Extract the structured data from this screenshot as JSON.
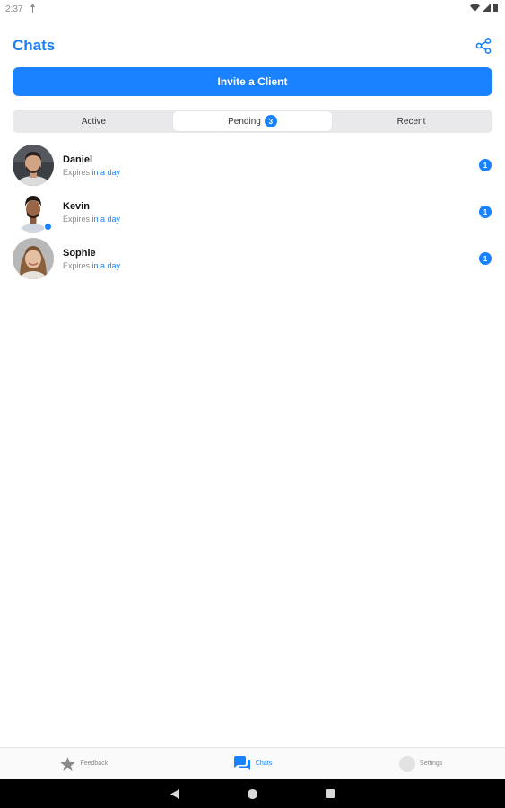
{
  "status_bar": {
    "time": "2:37"
  },
  "header": {
    "title": "Chats"
  },
  "invite": {
    "label": "Invite a Client"
  },
  "tabs": [
    {
      "label": "Active",
      "badge": ""
    },
    {
      "label": "Pending",
      "badge": "3"
    },
    {
      "label": "Recent",
      "badge": ""
    }
  ],
  "selected_tab": "Pending",
  "chats": [
    {
      "name": "Daniel",
      "expires_prefix": "Expires",
      "expires_value": "in a day",
      "unread": "1",
      "online": false
    },
    {
      "name": "Kevin",
      "expires_prefix": "Expires",
      "expires_value": "in a day",
      "unread": "1",
      "online": true
    },
    {
      "name": "Sophie",
      "expires_prefix": "Expires",
      "expires_value": "in a day",
      "unread": "1",
      "online": false
    }
  ],
  "bottom_nav": [
    {
      "label": "Feedback",
      "icon": "star-icon"
    },
    {
      "label": "Chats",
      "icon": "chat-bubbles-icon"
    },
    {
      "label": "Settings",
      "icon": "settings-avatar-icon"
    }
  ],
  "active_nav": "Chats",
  "colors": {
    "accent": "#1a82ff",
    "title": "#1f7ff2"
  }
}
